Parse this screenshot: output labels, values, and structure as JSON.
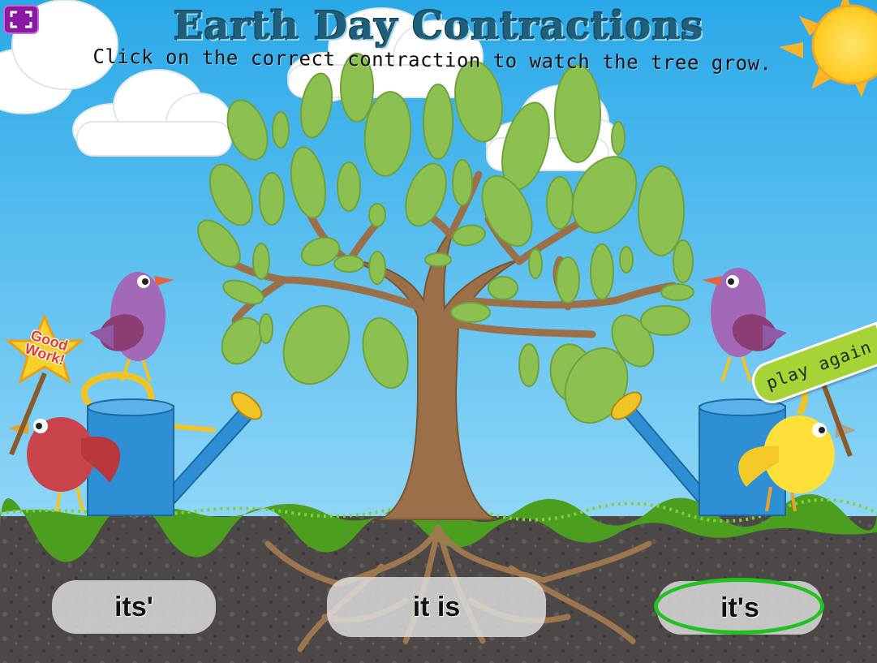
{
  "header": {
    "title": "Earth Day Contractions",
    "instructions": "Click on the correct contraction to watch the tree grow."
  },
  "controls": {
    "fullscreen_icon": "fullscreen-icon",
    "play_again_label": "play again"
  },
  "feedback": {
    "badge_text_line1": "Good",
    "badge_text_line2": "Work!"
  },
  "answers": [
    {
      "label": "its'"
    },
    {
      "label": "it is"
    },
    {
      "label": "it's",
      "highlighted": true
    }
  ],
  "colors": {
    "sky": "#35b3ec",
    "leaf": "#8cc152",
    "trunk": "#9b7048",
    "soil": "#4a4745",
    "grass": "#4c9e1f",
    "highlight_ring": "#22c11f",
    "play_again_sign": "#a6d437",
    "fullscreen_button": "#8b1aa2"
  }
}
